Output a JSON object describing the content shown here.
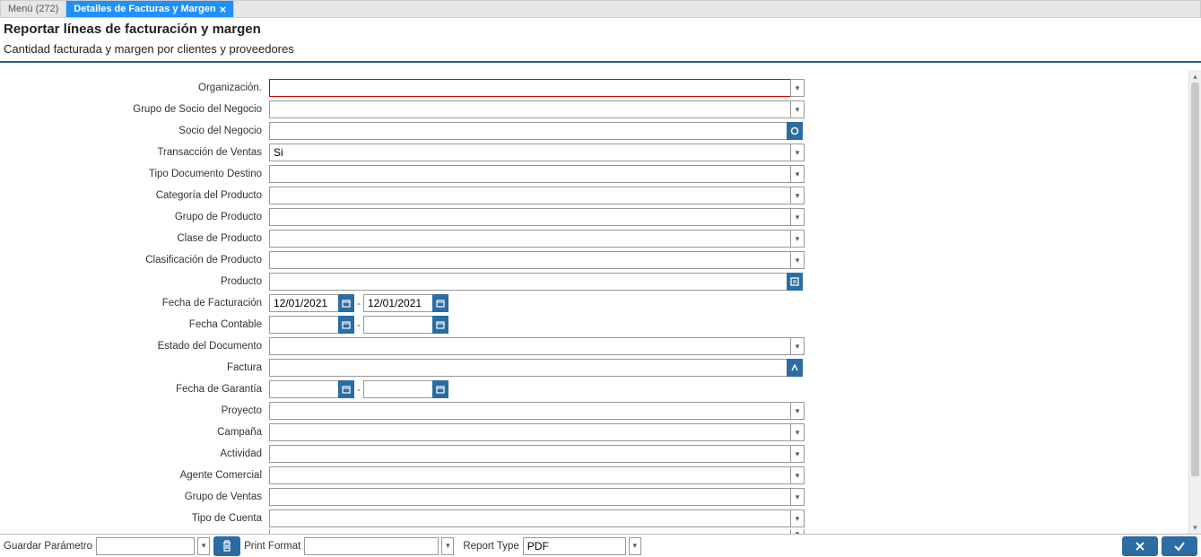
{
  "tabs": {
    "menu": "Menú (272)",
    "active": "Detalles de Facturas y Margen"
  },
  "header": {
    "title": "Reportar líneas de facturación y margen",
    "subtitle": "Cantidad facturada y margen por clientes y proveedores"
  },
  "fields": {
    "organizacion": {
      "label": "Organización.",
      "value": ""
    },
    "grupo_socio": {
      "label": "Grupo de Socio del Negocio",
      "value": ""
    },
    "socio": {
      "label": "Socio del Negocio",
      "value": ""
    },
    "transaccion": {
      "label": "Transacción de Ventas",
      "value": "Si"
    },
    "tipo_doc": {
      "label": "Tipo Documento Destino",
      "value": ""
    },
    "categoria_prod": {
      "label": "Categoría del Producto",
      "value": ""
    },
    "grupo_prod": {
      "label": "Grupo de Producto",
      "value": ""
    },
    "clase_prod": {
      "label": "Clase de Producto",
      "value": ""
    },
    "clasif_prod": {
      "label": "Clasificación de Producto",
      "value": ""
    },
    "producto": {
      "label": "Producto",
      "value": ""
    },
    "fecha_fact": {
      "label": "Fecha de Facturación",
      "from": "12/01/2021",
      "to": "12/01/2021"
    },
    "fecha_cont": {
      "label": "Fecha Contable",
      "from": "",
      "to": ""
    },
    "estado_doc": {
      "label": "Estado del Documento",
      "value": ""
    },
    "factura": {
      "label": "Factura",
      "value": ""
    },
    "fecha_gar": {
      "label": "Fecha de Garantía",
      "from": "",
      "to": ""
    },
    "proyecto": {
      "label": "Proyecto",
      "value": ""
    },
    "campana": {
      "label": "Campaña",
      "value": ""
    },
    "actividad": {
      "label": "Actividad",
      "value": ""
    },
    "agente": {
      "label": "Agente Comercial",
      "value": ""
    },
    "grupo_ventas": {
      "label": "Grupo de Ventas",
      "value": ""
    },
    "tipo_cuenta": {
      "label": "Tipo de Cuenta",
      "value": ""
    }
  },
  "statusbar": {
    "save_param_label": "Guardar Parámetro",
    "save_param_value": "",
    "print_format_label": "Print Format",
    "print_format_value": "",
    "report_type_label": "Report Type",
    "report_type_value": "PDF"
  }
}
